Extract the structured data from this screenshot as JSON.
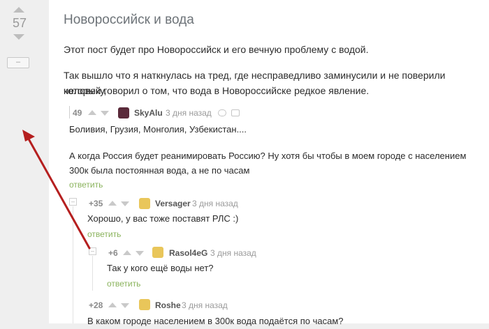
{
  "post": {
    "score": "57",
    "collapse_label": "–",
    "title": "Новороссийск и вода",
    "paragraph1": "Этот пост будет про Новороссийск и его вечную проблему с водой.",
    "paragraph2_line1": "Так вышло что я наткнулась на тред, где несправедливо заминусили и не поверили человеку,",
    "paragraph2_line2": "который говорил о том, что вода в Новороссийске редкое явление."
  },
  "comments": [
    {
      "rating": "49",
      "author": "SkyAlu",
      "time": "3 дня назад",
      "lines": [
        "Боливия, Грузия, Монголия, Узбекистан....",
        "",
        "А когда Россия будет реанимировать Россию? Ну хотя бы чтобы в моем городе с населением",
        "300к была постоянная вода, а не по часам"
      ],
      "reply": "ответить"
    },
    {
      "rating": "+35",
      "author": "Versager",
      "time": "3 дня назад",
      "lines": [
        "Хорошо, у вас тоже поставят РЛС :)"
      ],
      "reply": "ответить",
      "tree_toggle": "–"
    },
    {
      "rating": "+6",
      "author": "Rasol4eG",
      "time": "3 дня назад",
      "lines": [
        "Так у кого ещё воды нет?"
      ],
      "reply": "ответить",
      "tree_toggle": "–"
    },
    {
      "rating": "+28",
      "author": "Roshe",
      "time": "3 дня назад",
      "lines": [
        "В каком городе населением в 300к вода подаётся по часам?"
      ]
    }
  ],
  "colors": {
    "annotation_arrow": "#b51f1f",
    "reply_link": "#8ab35c",
    "avatar_skyalu": "#5a2a3a",
    "avatar_yellow": "#e9c65a"
  },
  "icons": [
    "arrow-up-icon",
    "arrow-down-icon",
    "link-icon",
    "save-icon",
    "red-annotation-arrow"
  ]
}
